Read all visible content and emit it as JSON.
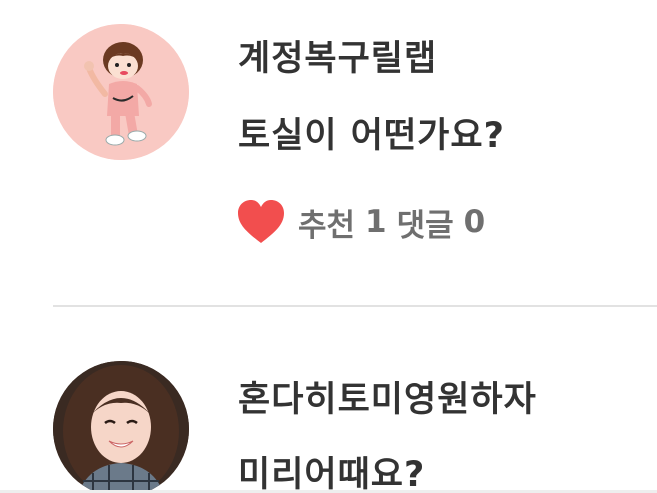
{
  "posts": [
    {
      "username": "계정복구릴랩",
      "question": "토실이 어떤가요?",
      "like_label": "추천",
      "like_count": "1",
      "comment_label": "댓글",
      "comment_count": "0",
      "avatar_icon": "cartoon-girl-avatar"
    },
    {
      "username": "혼다히토미영원하자",
      "question": "미리어때요?",
      "avatar_icon": "photo-avatar"
    }
  ],
  "colors": {
    "heart": "#f24e4e",
    "text": "#333333",
    "meta_text": "#6f6f6f",
    "avatar1_bg": "#f9c9c3",
    "divider": "#e2e2e2"
  }
}
